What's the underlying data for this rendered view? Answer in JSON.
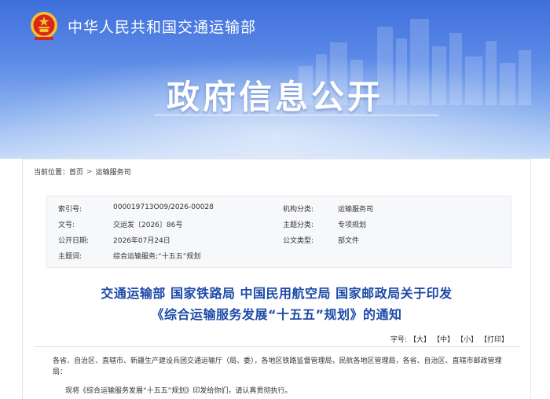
{
  "site": {
    "name": "中华人民共和国交通运输部",
    "section_title": "政府信息公开"
  },
  "breadcrumb": {
    "label": "当前位置：",
    "items": [
      "首页",
      "运输服务司"
    ],
    "separator": ">"
  },
  "meta": {
    "index_label": "索引号:",
    "index_value": "000019713O09/2026-00028",
    "org_label": "机构分类:",
    "org_value": "运输服务司",
    "doc_no_label": "文号:",
    "doc_no_value": "交运发〔2026〕86号",
    "topic_label": "主题分类:",
    "topic_value": "专项规划",
    "date_label": "公开日期:",
    "date_value": "2026年07月24日",
    "type_label": "公文类型:",
    "type_value": "部文件",
    "keywords_label": "主题词:",
    "keywords_value": "综合运输服务;“十五五”规划"
  },
  "document": {
    "title_line1": "交通运输部 国家铁路局 中国民用航空局 国家邮政局关于印发",
    "title_line2": "《综合运输服务发展“十五五”规划》的通知",
    "recipients": "各省、自治区、直辖市、新疆生产建设兵团交通运输厅（局、委），各地区铁路监督管理局，民航各地区管理局，各省、自治区、直辖市邮政管理局：",
    "body_first": "现将《综合运输服务发展“十五五”规划》印发给你们，请认真贯彻执行。"
  },
  "font_options": {
    "label": "字号:",
    "large": "【大】",
    "medium": "【中】",
    "small": "【小】",
    "print": "【打印】"
  },
  "colors": {
    "banner_blue": "#3f6fdc",
    "title_blue": "#1d4aa8",
    "emblem_red": "#d7261b",
    "emblem_gold": "#f2c230"
  }
}
